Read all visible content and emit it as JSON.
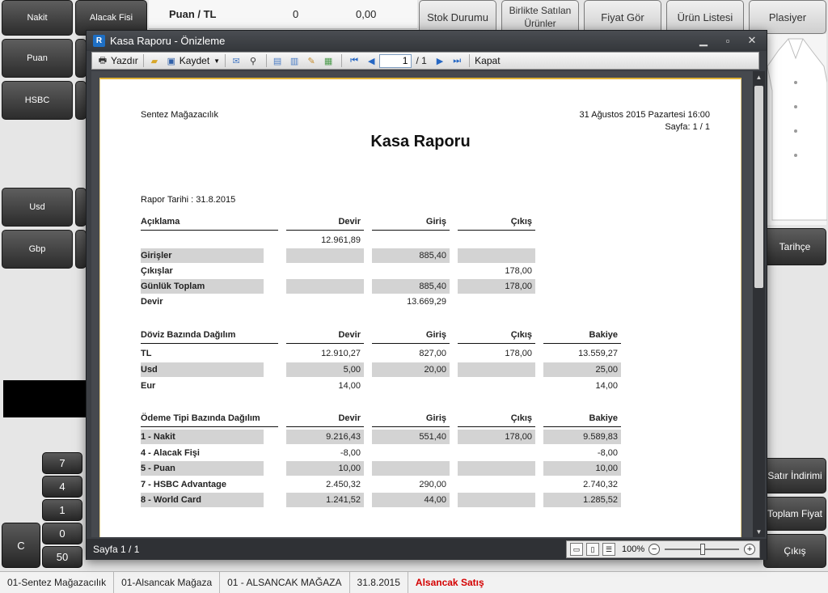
{
  "pos": {
    "left_buttons": [
      "Nakit",
      "Alacak Fisi",
      "Puan",
      "HSBC",
      "Usd",
      "Gbp"
    ],
    "total_label": "Puan / TL",
    "total_qty": "0",
    "total_amount": "0,00",
    "top_buttons": [
      "Stok Durumu",
      "Birlikte Satılan Ürünler",
      "Fiyat Gör",
      "Ürün Listesi",
      "Plasiyer"
    ],
    "right_buttons": [
      "Tarihçe",
      "Satır İndirimi",
      "Toplam Fiyat",
      "Çıkış"
    ],
    "keypad": [
      "7",
      "4",
      "1",
      "0",
      "50"
    ],
    "clear_key": "C"
  },
  "statusbar": [
    "01-Sentez Mağazacılık",
    "01-Alsancak Mağaza",
    "01 - ALSANCAK MAĞAZA",
    "31.8.2015",
    "Alsancak Satış"
  ],
  "colors": {
    "status_highlight": "#d40000",
    "page_border": "#e0b437",
    "row_shade": "#d3d3d3"
  },
  "window": {
    "title": "Kasa Raporu - Önizleme",
    "toolbar": {
      "print": "Yazdır",
      "save": "Kaydet",
      "page_value": "1",
      "page_total": "/ 1",
      "close": "Kapat"
    },
    "status_page": "Sayfa 1 / 1",
    "zoom": "100%"
  },
  "report": {
    "company": "Sentez Mağazacılık",
    "datetime": "31 Ağustos 2015 Pazartesi 16:00",
    "page": "Sayfa: 1 / 1",
    "title": "Kasa Raporu",
    "report_date": "Rapor Tarihi : 31.8.2015",
    "summary": {
      "headers": [
        "Açıklama",
        "Devir",
        "Giriş",
        "Çıkış"
      ],
      "opening": "12.961,89",
      "rows": [
        {
          "label": "Girişler",
          "devir": "",
          "giris": "885,40",
          "cikis": "",
          "shade": true
        },
        {
          "label": "Çıkışlar",
          "devir": "",
          "giris": "",
          "cikis": "178,00",
          "shade": false
        },
        {
          "label": "Günlük Toplam",
          "devir": "",
          "giris": "885,40",
          "cikis": "178,00",
          "shade": true
        },
        {
          "label": "Devir",
          "devir": "",
          "giris": "13.669,29",
          "cikis": "",
          "shade": false
        }
      ]
    },
    "currency": {
      "headers": [
        "Döviz Bazında Dağılım",
        "Devir",
        "Giriş",
        "Çıkış",
        "Bakiye"
      ],
      "rows": [
        {
          "label": "TL",
          "devir": "12.910,27",
          "giris": "827,00",
          "cikis": "178,00",
          "bakiye": "13.559,27",
          "shade": false
        },
        {
          "label": "Usd",
          "devir": "5,00",
          "giris": "20,00",
          "cikis": "",
          "bakiye": "25,00",
          "shade": true
        },
        {
          "label": "Eur",
          "devir": "14,00",
          "giris": "",
          "cikis": "",
          "bakiye": "14,00",
          "shade": false
        }
      ]
    },
    "payment": {
      "headers": [
        "Ödeme Tipi Bazında Dağılım",
        "Devir",
        "Giriş",
        "Çıkış",
        "Bakiye"
      ],
      "rows": [
        {
          "label": "1 - Nakit",
          "devir": "9.216,43",
          "giris": "551,40",
          "cikis": "178,00",
          "bakiye": "9.589,83",
          "shade": true
        },
        {
          "label": "4 - Alacak Fişi",
          "devir": "-8,00",
          "giris": "",
          "cikis": "",
          "bakiye": "-8,00",
          "shade": false
        },
        {
          "label": "5 - Puan",
          "devir": "10,00",
          "giris": "",
          "cikis": "",
          "bakiye": "10,00",
          "shade": true
        },
        {
          "label": "7 - HSBC Advantage",
          "devir": "2.450,32",
          "giris": "290,00",
          "cikis": "",
          "bakiye": "2.740,32",
          "shade": false
        },
        {
          "label": "8 - World Card",
          "devir": "1.241,52",
          "giris": "44,00",
          "cikis": "",
          "bakiye": "1.285,52",
          "shade": true
        }
      ]
    }
  }
}
